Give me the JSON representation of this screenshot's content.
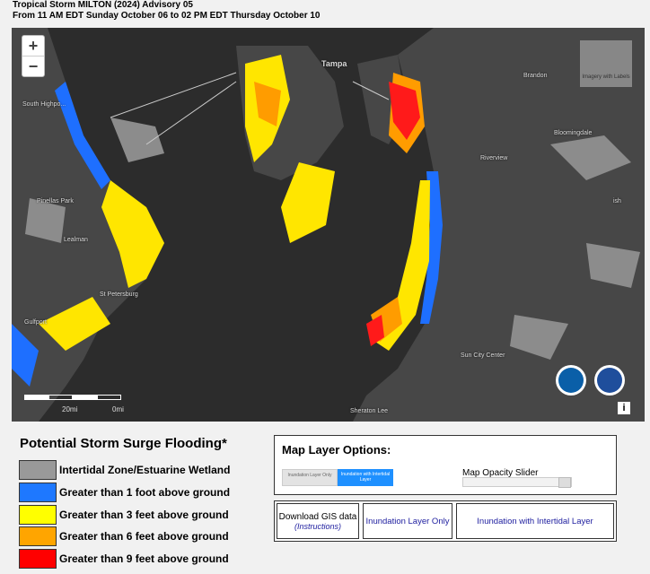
{
  "header": {
    "line1": "Tropical Storm MILTON (2024) Advisory 05",
    "line2": "From 11 AM EDT Sunday October 06 to 02 PM EDT Thursday October 10"
  },
  "map": {
    "zoom_in": "+",
    "zoom_out": "−",
    "basemap_label": "Imagery with Labels",
    "places": [
      "Tampa",
      "Brandon",
      "Bloomingdale",
      "Riverview",
      "South Highpo...",
      "Pinellas Park",
      "Lealman",
      "St Petersburg",
      "Gulfport",
      "Sun City Center",
      "Sheraton Lee",
      "ish"
    ],
    "scale_labels": [
      "20mi",
      "0mi"
    ],
    "info": "i",
    "colors": {
      "water": "#2c2c2c",
      "land": "#474747",
      "wetland": "#8c8c8c",
      "ft1": "#1e6fff",
      "ft3": "#ffe600",
      "ft6": "#ff9c00",
      "ft9": "#ff1a1a"
    }
  },
  "legend": {
    "title": "Potential Storm Surge Flooding*",
    "items": [
      {
        "label": "Intertidal Zone/Estuarine Wetland",
        "color": "#999999"
      },
      {
        "label": "Greater than 1 foot above ground",
        "color": "#1e78ff"
      },
      {
        "label": "Greater than 3 feet above ground",
        "color": "#ffff00"
      },
      {
        "label": "Greater than 6 feet above ground",
        "color": "#ffa500"
      },
      {
        "label": "Greater than 9 feet above ground",
        "color": "#ff0000"
      }
    ]
  },
  "options": {
    "title": "Map Layer Options:",
    "toggle_off": "Inundation Layer Only",
    "toggle_on": "Inundation with Intertidal Layer",
    "slider_label": "Map Opacity Slider",
    "opacity": 1.0
  },
  "downloads": {
    "gis": "Download GIS data",
    "instructions": "(Instructions)",
    "layer_only": "Inundation Layer Only",
    "with_intertidal": "Inundation with Intertidal Layer"
  }
}
